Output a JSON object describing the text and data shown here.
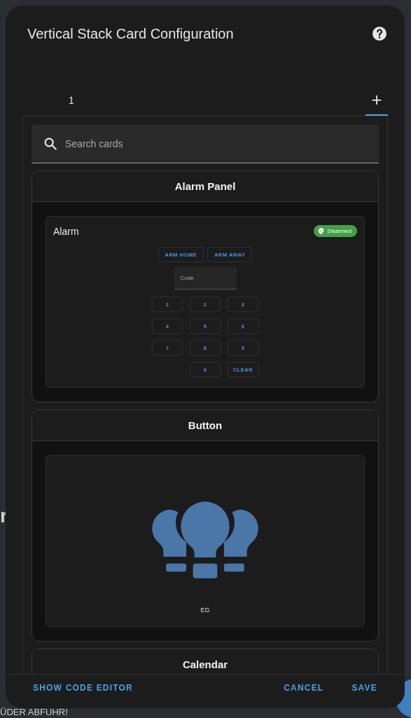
{
  "background": {
    "fragments": [
      {
        "text": "r",
        "kind": "big"
      }
    ],
    "footer_text": "ÜDER ABFUHR!"
  },
  "dialog": {
    "title": "Vertical Stack Card Configuration",
    "tabs": [
      {
        "label": "1",
        "selected": false
      },
      {
        "label": "+",
        "selected": true
      }
    ],
    "search": {
      "placeholder": "Search cards"
    },
    "cards": [
      {
        "title": "Alarm Panel",
        "kind": "alarm",
        "preview": {
          "name": "Alarm",
          "badge": "Disarmed",
          "actions": [
            "ARM HOME",
            "ARM AWAY"
          ],
          "code_placeholder": "Code",
          "keys": [
            "1",
            "2",
            "3",
            "4",
            "5",
            "6",
            "7",
            "8",
            "9",
            "0",
            "CLEAR"
          ]
        }
      },
      {
        "title": "Button",
        "kind": "button",
        "preview": {
          "name": "EG"
        }
      },
      {
        "title": "Calendar",
        "kind": "calendar"
      }
    ],
    "footer": {
      "left": "SHOW CODE EDITOR",
      "actions": [
        "CANCEL",
        "SAVE"
      ]
    }
  }
}
